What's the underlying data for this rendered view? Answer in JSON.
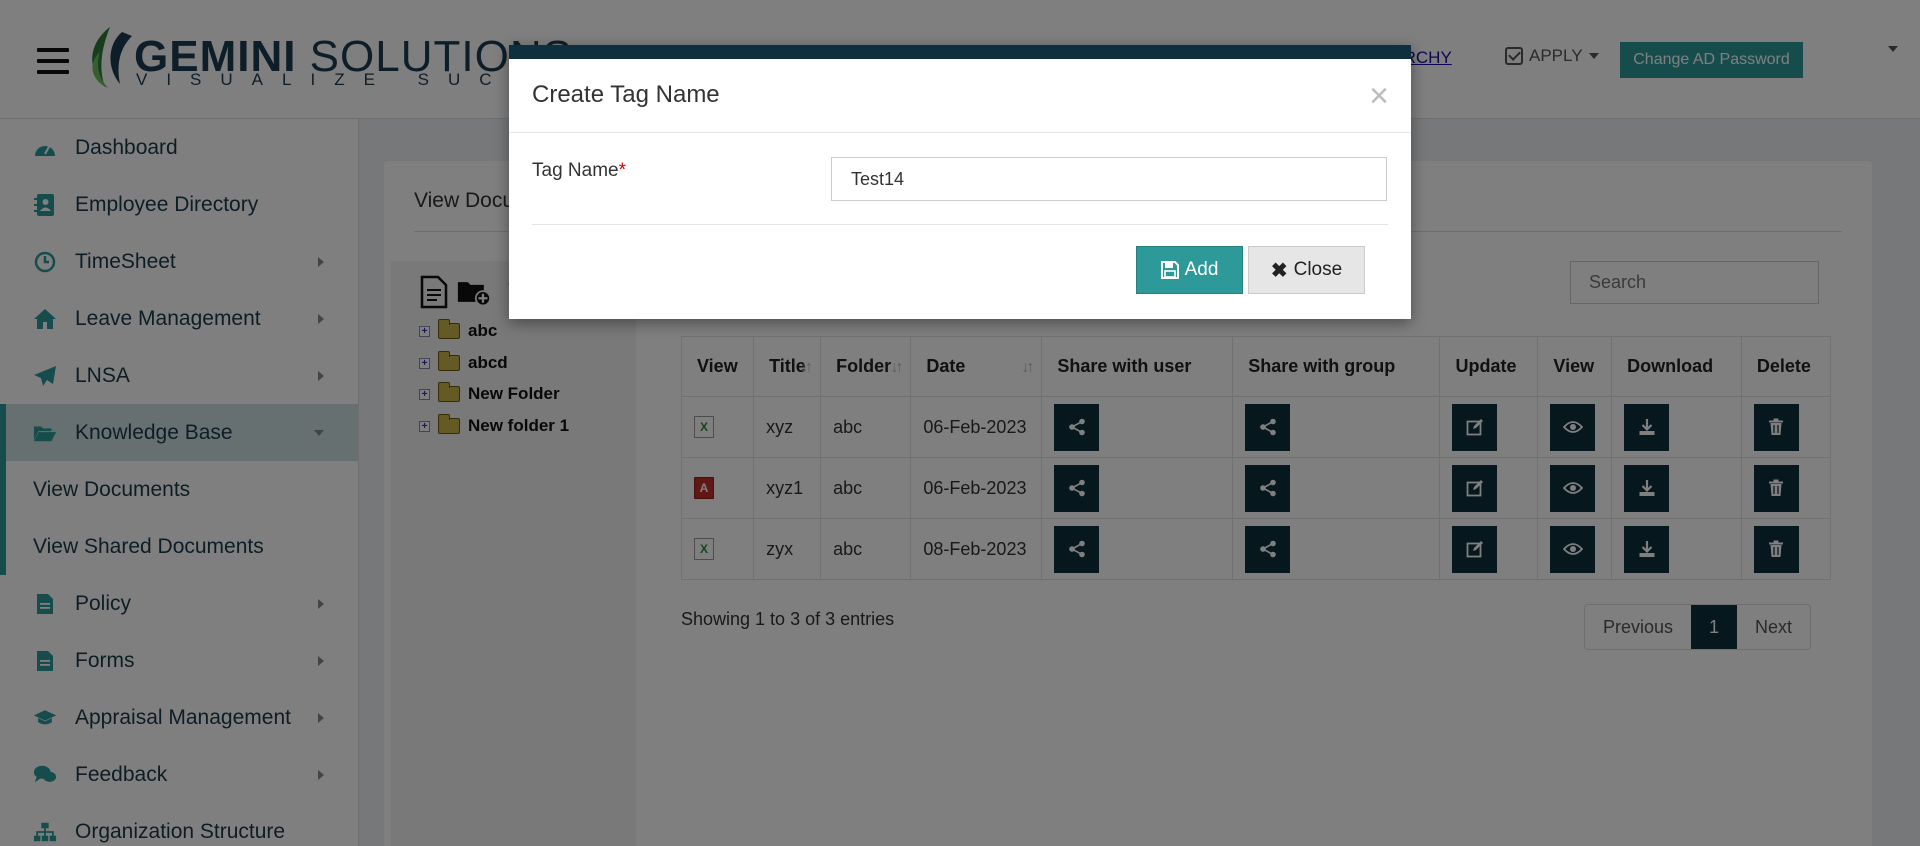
{
  "header": {
    "logo_main_1": "GEMINI",
    "logo_main_2": " SOLUTIONS",
    "logo_sub": "VISUALIZE SUCCESS",
    "hierarchy_link": "RARCHY",
    "apply_label": "APPLY",
    "change_password_label": "Change AD Password"
  },
  "sidebar": {
    "items": [
      {
        "label": "Dashboard",
        "icon": "dashboard-icon"
      },
      {
        "label": "Employee Directory",
        "icon": "address-book-icon"
      },
      {
        "label": "TimeSheet",
        "icon": "clock-icon"
      },
      {
        "label": "Leave Management",
        "icon": "home-icon"
      },
      {
        "label": "LNSA",
        "icon": "paper-plane-icon"
      },
      {
        "label": "Knowledge Base",
        "icon": "folder-open-icon"
      },
      {
        "label": "View Documents"
      },
      {
        "label": "View Shared Documents"
      },
      {
        "label": "Policy",
        "icon": "document-icon"
      },
      {
        "label": "Forms",
        "icon": "document-icon"
      },
      {
        "label": "Appraisal Management",
        "icon": "graduation-cap-icon"
      },
      {
        "label": "Feedback",
        "icon": "comments-icon"
      },
      {
        "label": "Organization Structure",
        "icon": "sitemap-icon"
      }
    ]
  },
  "main": {
    "title": "View Documents",
    "search_placeholder": "Search",
    "tree": {
      "folders": [
        "abc",
        "abcd",
        "New Folder",
        "New folder 1"
      ]
    },
    "table": {
      "columns": [
        "View",
        "Title",
        "Folder",
        "Date",
        "Share with user",
        "Share with group",
        "Update",
        "View",
        "Download",
        "Delete"
      ],
      "rows": [
        {
          "type": "xls",
          "title": "xyz",
          "folder": "abc",
          "date": "06-Feb-2023"
        },
        {
          "type": "pdf",
          "title": "xyz1",
          "folder": "abc",
          "date": "06-Feb-2023"
        },
        {
          "type": "xls",
          "title": "zyx",
          "folder": "abc",
          "date": "08-Feb-2023"
        }
      ]
    },
    "entries_text": "Showing 1 to 3 of 3 entries",
    "pager": {
      "previous": "Previous",
      "current": "1",
      "next": "Next"
    }
  },
  "modal": {
    "title": "Create Tag Name",
    "field_label": "Tag Name",
    "required_mark": "*",
    "field_value": "Test14",
    "add_label": "Add",
    "close_label": "Close"
  },
  "colors": {
    "accent": "#2d9a99",
    "dark": "#0e2f3d"
  }
}
